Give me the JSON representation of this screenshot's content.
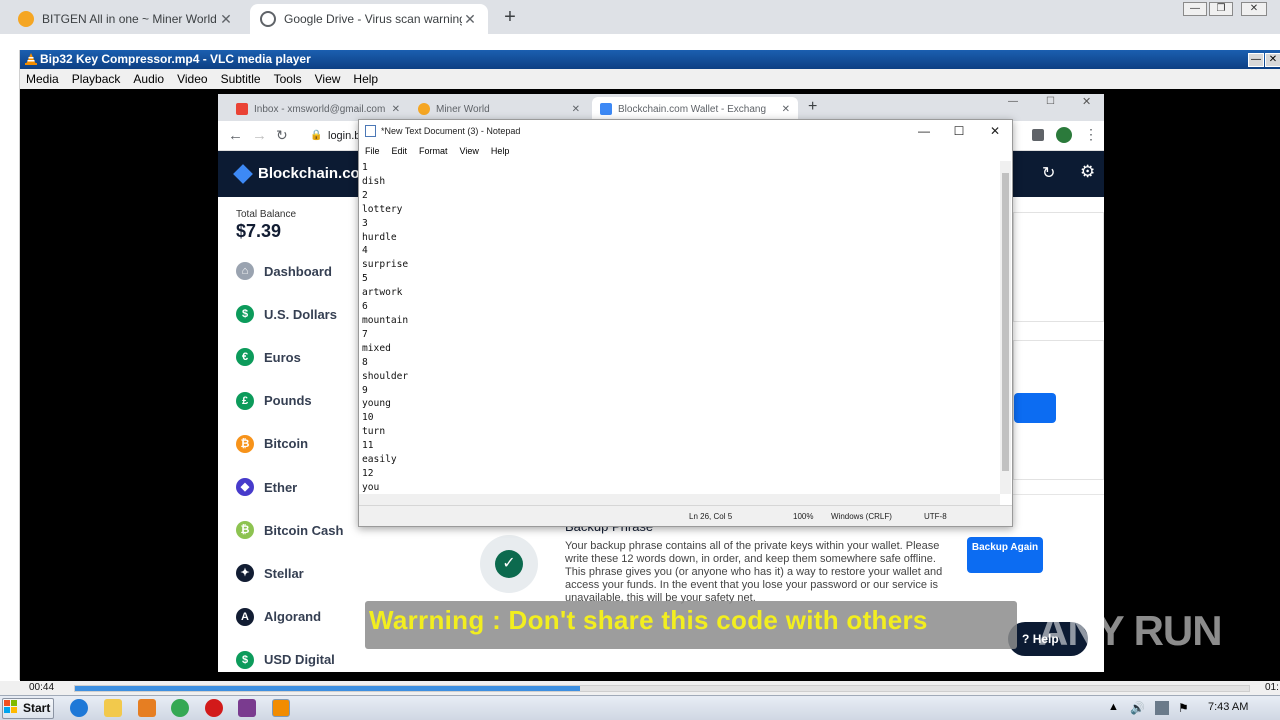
{
  "host_browser": {
    "tabs": [
      {
        "title": "BITGEN All in one ~ Miner World",
        "active": false
      },
      {
        "title": "Google Drive - Virus scan warning",
        "active": true
      }
    ],
    "new_tab_symbol": "+"
  },
  "vlc": {
    "title": "Bip32 Key Compressor.mp4 - VLC media player",
    "menu": [
      "Media",
      "Playback",
      "Audio",
      "Video",
      "Subtitle",
      "Tools",
      "View",
      "Help"
    ],
    "time_elapsed": "00:44",
    "time_total": "01:",
    "progress_fraction": 0.43
  },
  "inner_browser": {
    "tabs": [
      {
        "title": "Inbox - xmsworld@gmail.com - G",
        "active": false
      },
      {
        "title": "Miner World",
        "active": false
      },
      {
        "title": "Blockchain.com Wallet - Exchang",
        "active": true
      }
    ],
    "address": "login.b"
  },
  "blockchain": {
    "logo_text": "Blockchain.co",
    "total_balance_label": "Total Balance",
    "total_balance": "$7.39",
    "nav": [
      {
        "label": "Dashboard",
        "icon": "home-icon",
        "color": "#9aa3b0",
        "glyph": "⌂"
      },
      {
        "label": "U.S. Dollars",
        "icon": "dollar-icon",
        "color": "#0c9b5b",
        "glyph": "$"
      },
      {
        "label": "Euros",
        "icon": "euro-icon",
        "color": "#0c9b5b",
        "glyph": "€"
      },
      {
        "label": "Pounds",
        "icon": "pound-icon",
        "color": "#0c9b5b",
        "glyph": "£"
      },
      {
        "label": "Bitcoin",
        "icon": "bitcoin-icon",
        "color": "#f7931a",
        "glyph": "₿"
      },
      {
        "label": "Ether",
        "icon": "ether-icon",
        "color": "#473bcb",
        "glyph": "◆"
      },
      {
        "label": "Bitcoin Cash",
        "icon": "bitcoin-cash-icon",
        "color": "#8dc351",
        "glyph": "₿"
      },
      {
        "label": "Stellar",
        "icon": "stellar-icon",
        "color": "#121d33",
        "glyph": "✦"
      },
      {
        "label": "Algorand",
        "icon": "algorand-icon",
        "color": "#121d33",
        "glyph": "A"
      },
      {
        "label": "USD Digital",
        "icon": "usd-digital-icon",
        "color": "#0c9b5b",
        "glyph": "$"
      }
    ],
    "backup": {
      "title": "Backup Phrase",
      "text": "Your backup phrase contains all of the private keys within your wallet. Please write these 12 words down, in order, and keep them somewhere safe offline. This phrase gives you (or anyone who has it) a way to restore your wallet and access your funds. In the event that you lose your password or our service is unavailable, this will be your safety net.",
      "button": "Backup Again"
    },
    "help_label": "Help"
  },
  "notepad": {
    "title": "*New Text Document (3) - Notepad",
    "menu": [
      "File",
      "Edit",
      "Format",
      "View",
      "Help"
    ],
    "lines": [
      "1",
      "dish",
      "2",
      "lottery",
      "3",
      "hurdle",
      "4",
      "surprise",
      "5",
      "artwork",
      "6",
      "mountain",
      "7",
      "mixed",
      "8",
      "shoulder",
      "9",
      "young",
      "10",
      "turn",
      "11",
      "easily",
      "12",
      "you"
    ],
    "status": {
      "position": "Ln 26, Col 5",
      "zoom": "100%",
      "line_ending": "Windows (CRLF)",
      "encoding": "UTF-8"
    }
  },
  "subtitle": "Warrning : Don't share this code with others",
  "watermark": "ANY RUN",
  "taskbar": {
    "start_label": "Start",
    "clock": "7:43 AM"
  },
  "colors": {
    "vlc_title": "#1b5fb0",
    "blockchain_header": "#0c1b33",
    "blockchain_button": "#0c6cf2",
    "subtitle_text": "#f2ee1f",
    "seek_fill": "#3d8fe0"
  }
}
